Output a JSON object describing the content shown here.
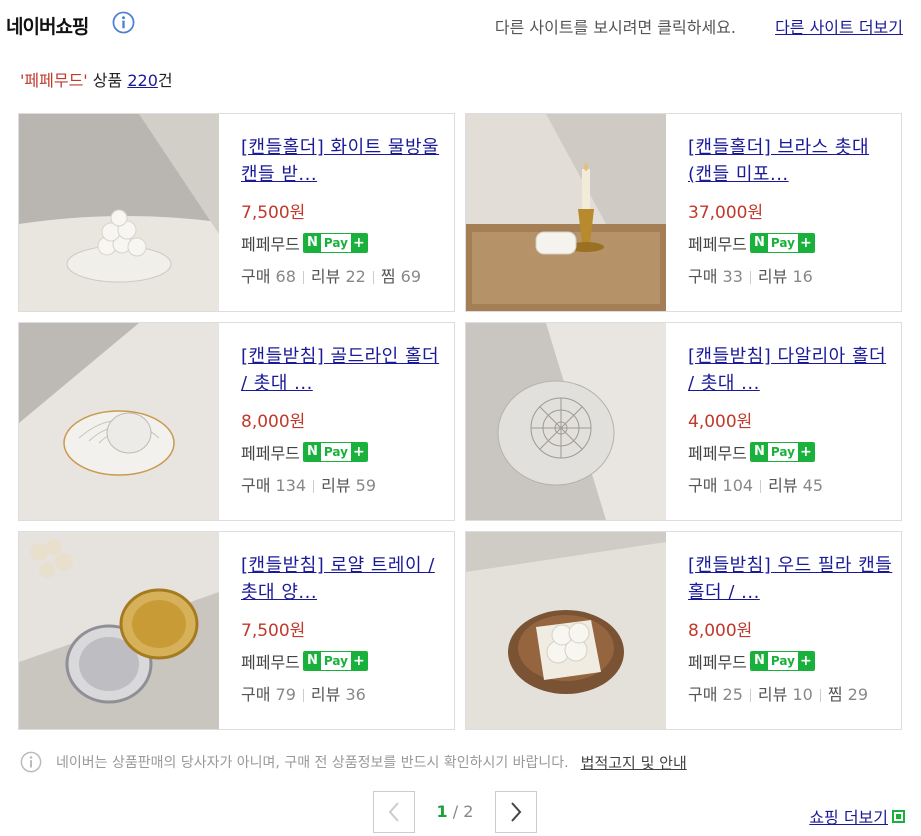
{
  "header": {
    "logo": "네이버쇼핑",
    "hint": "다른 사이트를 보시려면 클릭하세요.",
    "more_sites": "다른 사이트 더보기"
  },
  "summary": {
    "quote_open": "'",
    "keyword": "페페무드",
    "quote_close": "'",
    "label": " 상품 ",
    "count": "220",
    "unit": "건"
  },
  "stat_labels": {
    "buy": "구매",
    "review": "리뷰",
    "wish": "찜"
  },
  "npay": {
    "n": "N",
    "pay": "Pay",
    "plus": "+"
  },
  "products": [
    {
      "title": "[캔들홀더] 화이트 물방울 캔들 받...",
      "price": "7,500원",
      "seller": "페페무드",
      "buy": "68",
      "review": "22",
      "wish": "69",
      "image": "white-candle-plate"
    },
    {
      "title": "[캔들홀더] 브라스 촛대 (캔들 미포...",
      "price": "37,000원",
      "seller": "페페무드",
      "buy": "33",
      "review": "16",
      "image": "brass-candle-holder"
    },
    {
      "title": "[캔들받침] 골드라인 홀더 / 촛대 ...",
      "price": "8,000원",
      "seller": "페페무드",
      "buy": "134",
      "review": "59",
      "image": "glass-goldline-plate"
    },
    {
      "title": "[캔들받침] 다알리아 홀더 / 촛대 ...",
      "price": "4,000원",
      "seller": "페페무드",
      "buy": "104",
      "review": "45",
      "image": "glass-dahlia-holder"
    },
    {
      "title": "[캔들받침] 로얄 트레이 / 촛대 양...",
      "price": "7,500원",
      "seller": "페페무드",
      "buy": "79",
      "review": "36",
      "image": "royal-trays"
    },
    {
      "title": "[캔들받침] 우드 필라 캔들 홀더 / ...",
      "price": "8,000원",
      "seller": "페페무드",
      "buy": "25",
      "review": "10",
      "wish": "29",
      "image": "wood-pillar-plate"
    }
  ],
  "footer": {
    "notice": "네이버는 상품판매의 당사자가 아니며, 구매 전 상품정보를 반드시 확인하시기 바랍니다.",
    "legal_link": "법적고지 및 안내",
    "page_current": "1",
    "page_sep": " / ",
    "page_total": "2",
    "shopping_more": "쇼핑 더보기"
  },
  "colors": {
    "link": "#1a1a99",
    "price": "#c0392b",
    "npay_green": "#19b13b",
    "current_page": "#19a33a"
  }
}
